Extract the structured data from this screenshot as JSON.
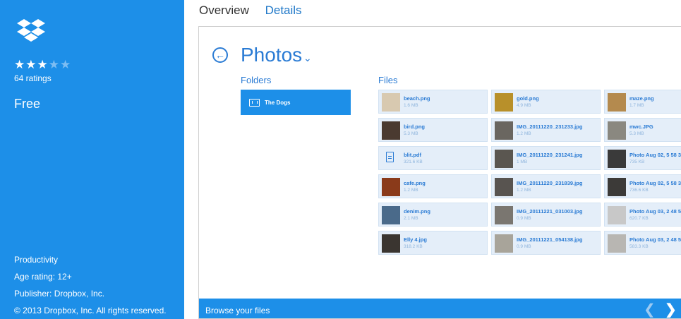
{
  "sidebar": {
    "rating_stars_filled": 3,
    "rating_stars_total": 5,
    "ratings_text": "64 ratings",
    "price": "Free",
    "category": "Productivity",
    "age_rating": "Age rating: 12+",
    "publisher": "Publisher: Dropbox, Inc.",
    "copyright": "© 2013 Dropbox, Inc. All rights reserved."
  },
  "tabs": [
    {
      "label": "Overview"
    },
    {
      "label": "Details"
    }
  ],
  "preview": {
    "title": "Photos",
    "folders_label": "Folders",
    "files_label": "Files",
    "folders": [
      {
        "label": "The Dogs"
      }
    ],
    "files": [
      {
        "name": "beach.png",
        "size": "1.6 MB",
        "thumb": "#d8c9b0"
      },
      {
        "name": "gold.png",
        "size": "4.9 MB",
        "thumb": "#b8902a"
      },
      {
        "name": "maze.png",
        "size": "1.7 MB",
        "thumb": "#b48a4e"
      },
      {
        "name": "bird.png",
        "size": "5.3 MB",
        "thumb": "#4a3a30"
      },
      {
        "name": "IMG_20111220_231233.jpg",
        "size": "1.2 MB",
        "thumb": "#6a6660"
      },
      {
        "name": "mwc.JPG",
        "size": "5.3 MB",
        "thumb": "#8a8880"
      },
      {
        "name": "blit.pdf",
        "size": "321.6 KB",
        "thumb": "doc-icon"
      },
      {
        "name": "IMG_20111220_231241.jpg",
        "size": "1 MB",
        "thumb": "#5a5650"
      },
      {
        "name": "Photo Aug 02, 5 58 3",
        "size": "735 KB",
        "thumb": "#3a3a3a"
      },
      {
        "name": "cafe.png",
        "size": "1.2 MB",
        "thumb": "#8a3a1a"
      },
      {
        "name": "IMG_20111220_231839.jpg",
        "size": "1.2 MB",
        "thumb": "#585450"
      },
      {
        "name": "Photo Aug 02, 5 58 3",
        "size": "736.6 KB",
        "thumb": "#3c3a38"
      },
      {
        "name": "denim.png",
        "size": "2.1 MB",
        "thumb": "#4a6a8a"
      },
      {
        "name": "IMG_20111221_031003.jpg",
        "size": "0.9 MB",
        "thumb": "#7a7670"
      },
      {
        "name": "Photo Aug 03, 2 48 5",
        "size": "620.7 KB",
        "thumb": "#c8c8c8"
      },
      {
        "name": "Elly 4.jpg",
        "size": "318.2 KB",
        "thumb": "#3a3530"
      },
      {
        "name": "IMG_20111221_054138.jpg",
        "size": "0.9 MB",
        "thumb": "#a8a49a"
      },
      {
        "name": "Photo Aug 03, 2 48 5",
        "size": "583.3 KB",
        "thumb": "#b8b6b2"
      }
    ],
    "bottom_bar_label": "Browse your files"
  },
  "colors": {
    "accent": "#1d8fe8",
    "link": "#2a7bd4",
    "tile_bg": "#e4eef9"
  }
}
